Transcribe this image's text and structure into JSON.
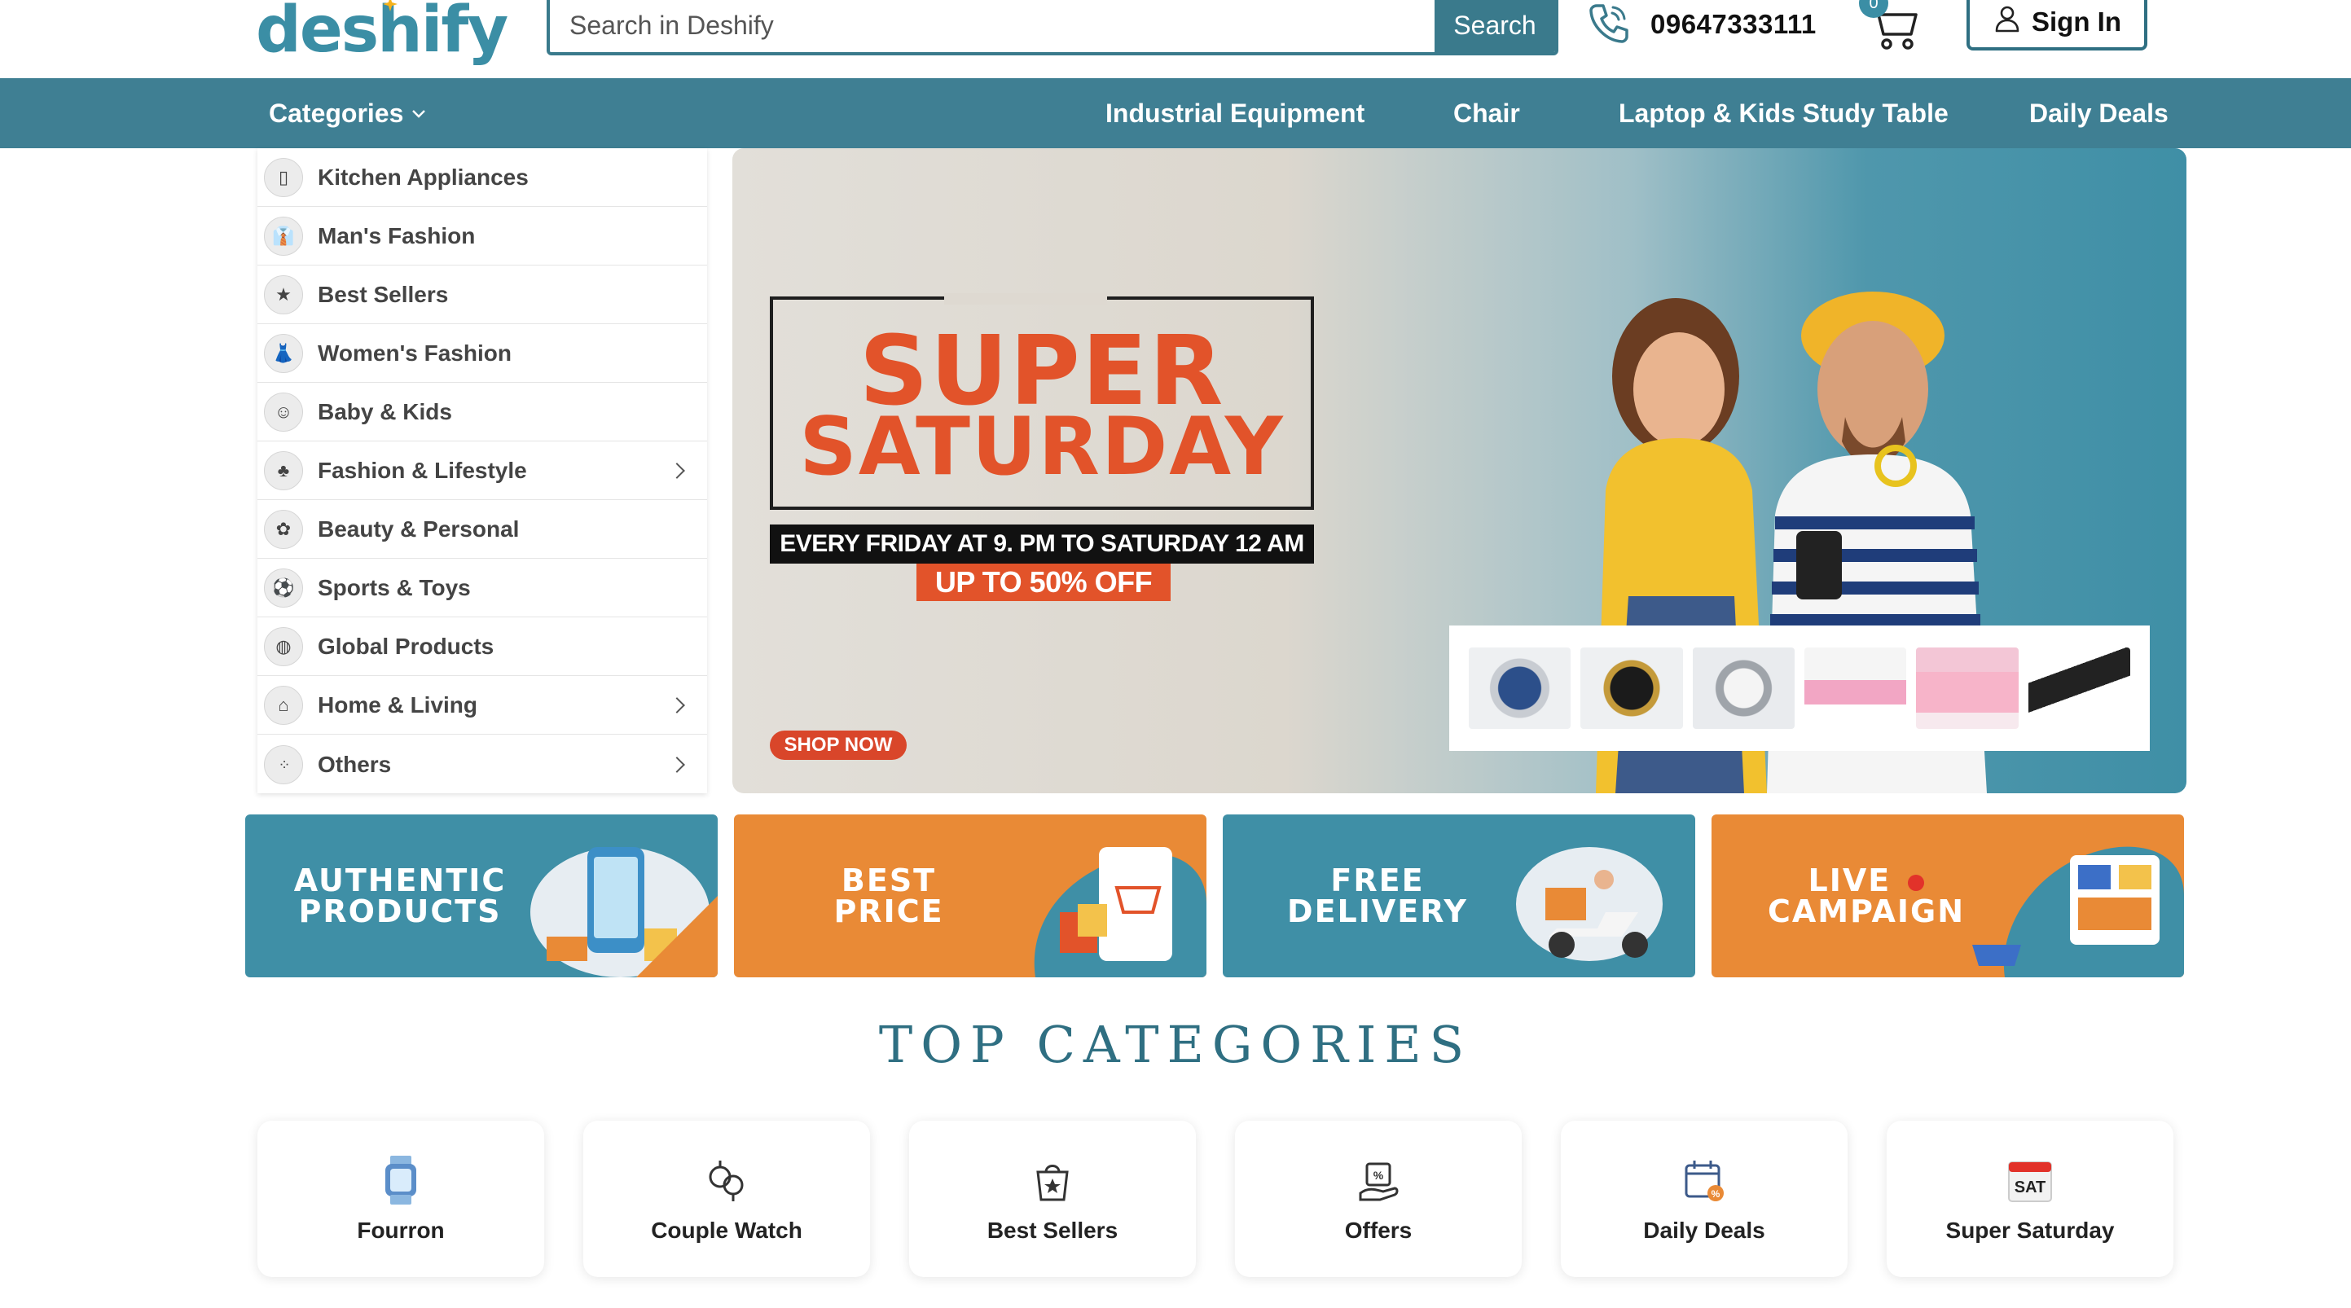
{
  "brand": {
    "logo_text": "deshify"
  },
  "search": {
    "placeholder": "Search in Deshify",
    "value": "",
    "button_label": "Search"
  },
  "contact": {
    "phone": "09647333111",
    "phone_icon": "phone-icon"
  },
  "cart": {
    "count": "0",
    "icon": "cart-icon"
  },
  "account": {
    "signin_label": "Sign In",
    "icon": "user-icon"
  },
  "nav": {
    "categories_label": "Categories",
    "links": [
      "Industrial Equipment",
      "Chair",
      "Laptop & Kids Study Table",
      "Daily Deals"
    ]
  },
  "sidebar": {
    "items": [
      {
        "label": "Kitchen Appliances",
        "icon": "kitchen-icon",
        "has_submenu": false
      },
      {
        "label": "Man's Fashion",
        "icon": "shirt-icon",
        "has_submenu": false
      },
      {
        "label": "Best Sellers",
        "icon": "best-seller-icon",
        "has_submenu": false
      },
      {
        "label": "Women's Fashion",
        "icon": "dress-icon",
        "has_submenu": false
      },
      {
        "label": "Baby & Kids",
        "icon": "baby-icon",
        "has_submenu": false
      },
      {
        "label": "Fashion & Lifestyle",
        "icon": "lifestyle-icon",
        "has_submenu": true
      },
      {
        "label": "Beauty & Personal",
        "icon": "beauty-icon",
        "has_submenu": false
      },
      {
        "label": "Sports & Toys",
        "icon": "sports-icon",
        "has_submenu": false
      },
      {
        "label": "Global Products",
        "icon": "globe-icon",
        "has_submenu": false
      },
      {
        "label": "Home & Living",
        "icon": "home-icon",
        "has_submenu": true
      },
      {
        "label": "Others",
        "icon": "dots-icon",
        "has_submenu": true
      }
    ]
  },
  "hero": {
    "title_line1": "SUPER",
    "title_line2": "SATURDAY",
    "subtitle": "EVERY FRIDAY AT 9. PM  TO SATURDAY 12 AM",
    "offer": "UP TO 50% OFF",
    "cta": "SHOP NOW",
    "accent": "#e2532a",
    "products": [
      "watch-blue",
      "watch-black",
      "watch-silver",
      "kids-table-pink",
      "kids-table-pink-2",
      "gadget-black"
    ]
  },
  "promos": [
    {
      "line1": "AUTHENTIC",
      "line2": "PRODUCTS",
      "color": "#3f8fa6"
    },
    {
      "line1": "BEST",
      "line2": "PRICE",
      "color": "#e98a36"
    },
    {
      "line1": "FREE",
      "line2": "DELIVERY",
      "color": "#3f8fa6"
    },
    {
      "line1": "LIVE",
      "line2": "CAMPAIGN",
      "color": "#e98a36"
    }
  ],
  "top_categories": {
    "title": "TOP CATEGORIES",
    "items": [
      {
        "label": "Fourron",
        "icon": "smartwatch-icon"
      },
      {
        "label": "Couple Watch",
        "icon": "couple-watch-icon"
      },
      {
        "label": "Best Sellers",
        "icon": "best-seller-icon"
      },
      {
        "label": "Offers",
        "icon": "offers-icon"
      },
      {
        "label": "Daily Deals",
        "icon": "calendar-icon"
      },
      {
        "label": "Super Saturday",
        "icon": "sat-calendar-icon",
        "icon_text": "SAT"
      }
    ]
  },
  "colors": {
    "primary": "#3f7f93",
    "teal": "#3f8fa6",
    "orange": "#e98a36",
    "accent_red": "#e2532a"
  }
}
